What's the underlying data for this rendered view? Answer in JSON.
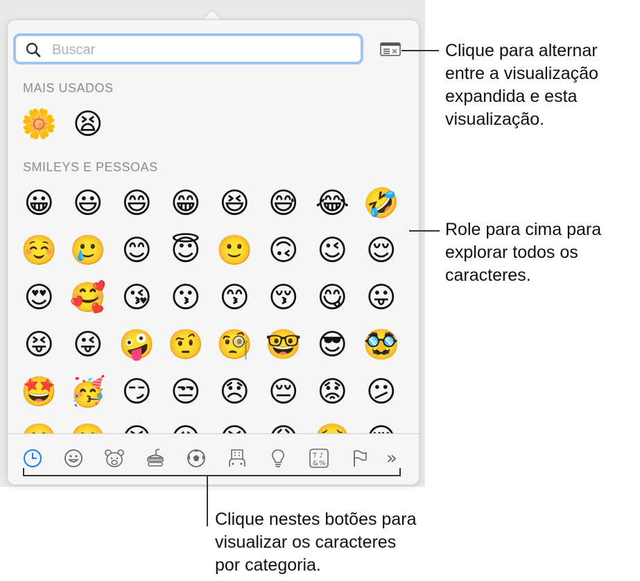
{
  "search": {
    "placeholder": "Buscar"
  },
  "sections": {
    "frequent": {
      "label": "MAIS USADOS",
      "emojis": [
        "🌼",
        "😫"
      ]
    },
    "smileys": {
      "label": "SMILEYS E PESSOAS",
      "rows": [
        [
          "😀",
          "😃",
          "😄",
          "😁",
          "😆",
          "😅",
          "😂",
          "🤣"
        ],
        [
          "☺️",
          "🥲",
          "😊",
          "😇",
          "🙂",
          "🙃",
          "😉",
          "😌"
        ],
        [
          "😍",
          "🥰",
          "😘",
          "😗",
          "😙",
          "😚",
          "😋",
          "😛"
        ],
        [
          "😝",
          "😜",
          "🤪",
          "🤨",
          "🧐",
          "🤓",
          "😎",
          "🥸"
        ],
        [
          "🤩",
          "🥳",
          "😏",
          "😒",
          "😞",
          "😔",
          "😟",
          "😕"
        ],
        [
          "🙁",
          "☹️",
          "😣",
          "😖",
          "😫",
          "😩",
          "🥺",
          "😢"
        ]
      ]
    }
  },
  "tabs": [
    {
      "icon": "clock-icon",
      "active": true
    },
    {
      "icon": "smiley-icon"
    },
    {
      "icon": "animal-icon"
    },
    {
      "icon": "food-icon"
    },
    {
      "icon": "ball-icon"
    },
    {
      "icon": "building-icon"
    },
    {
      "icon": "lightbulb-icon"
    },
    {
      "icon": "symbols-icon"
    },
    {
      "icon": "flag-icon"
    },
    {
      "icon": "more-icon",
      "label": "»"
    }
  ],
  "accent_color": "#1a7cf5",
  "callouts": {
    "view_toggle": [
      "Clique para alternar",
      "entre a visualização",
      "expandida e esta",
      "visualização."
    ],
    "scroll": [
      "Role para cima para",
      "explorar todos os",
      "caracteres."
    ],
    "categories": [
      "Clique nestes botões para",
      "visualizar os caracteres",
      "por categoria."
    ]
  }
}
